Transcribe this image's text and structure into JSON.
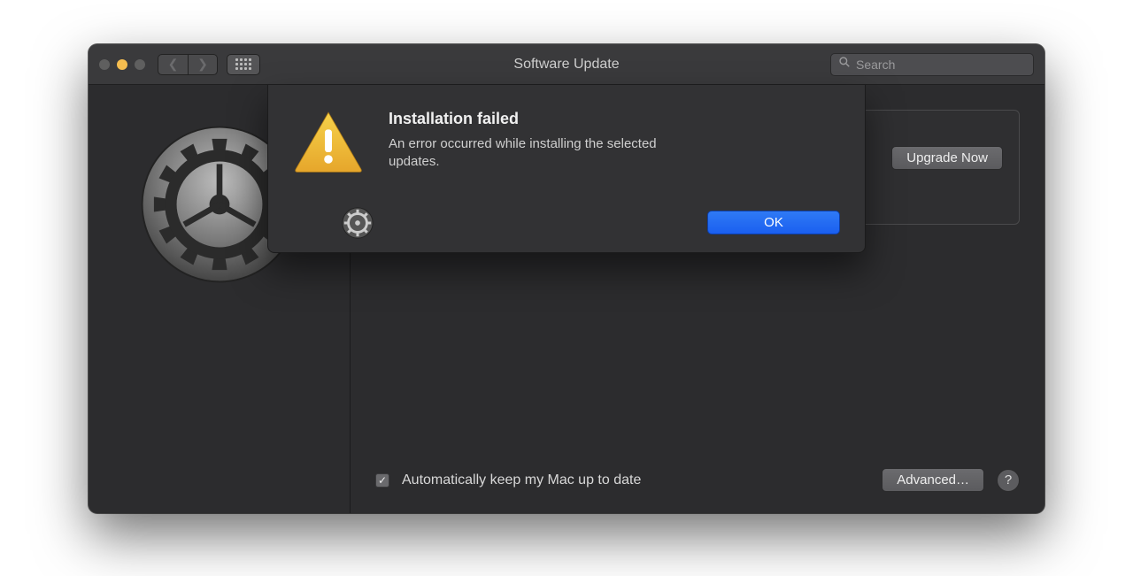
{
  "window": {
    "title": "Software Update"
  },
  "search": {
    "placeholder": "Search",
    "value": ""
  },
  "main": {
    "upgrade_button": "Upgrade Now",
    "auto_update_checked": true,
    "auto_update_label": "Automatically keep my Mac up to date",
    "advanced_button": "Advanced…",
    "help_label": "?"
  },
  "alert": {
    "title": "Installation failed",
    "message": "An error occurred while installing the selected updates.",
    "ok_label": "OK"
  }
}
